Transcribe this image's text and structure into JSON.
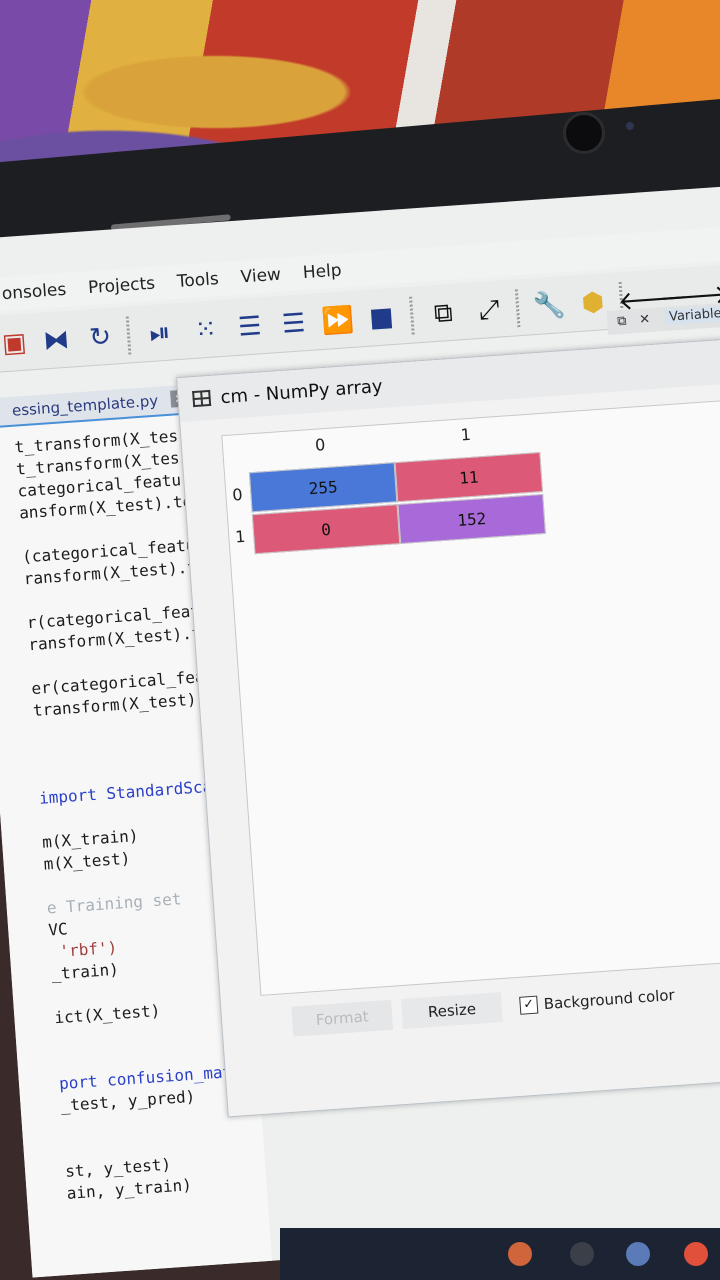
{
  "menu": {
    "items": [
      "onsoles",
      "Projects",
      "Tools",
      "View",
      "Help"
    ]
  },
  "toolbar": {
    "icons": [
      "run-cell-icon",
      "debug-icon",
      "indent-icon",
      "outdent-icon",
      "fast-forward-icon",
      "stop-icon",
      "maximize-pane-icon",
      "fullscreen-icon",
      "wrench-icon",
      "python-icon",
      "back-arrow-icon",
      "forward-arrow-icon"
    ]
  },
  "right_pane": {
    "label": "Variable"
  },
  "editor": {
    "tab_title": "essing_template.py",
    "tab_close": "×",
    "lines": [
      {
        "t": "t_transform(X_tes",
        "cls": ""
      },
      {
        "t": "t_transform(X_tes",
        "cls": ""
      },
      {
        "t": "categorical_featu",
        "cls": ""
      },
      {
        "t": "ansform(X_test).to",
        "cls": ""
      },
      {
        "t": "",
        "cls": ""
      },
      {
        "t": "(categorical_featu",
        "cls": ""
      },
      {
        "t": "ransform(X_test).to",
        "cls": ""
      },
      {
        "t": "",
        "cls": ""
      },
      {
        "t": "r(categorical_featu",
        "cls": ""
      },
      {
        "t": "ransform(X_test).to",
        "cls": ""
      },
      {
        "t": "",
        "cls": ""
      },
      {
        "t": "er(categorical_featu",
        "cls": ""
      },
      {
        "t": "transform(X_test).to",
        "cls": ""
      },
      {
        "t": "",
        "cls": ""
      },
      {
        "t": "",
        "cls": ""
      },
      {
        "t": "",
        "cls": ""
      },
      {
        "t": "import StandardScaler",
        "cls": "k"
      },
      {
        "t": "",
        "cls": ""
      },
      {
        "t": "m(X_train)",
        "cls": ""
      },
      {
        "t": "m(X_test)",
        "cls": ""
      },
      {
        "t": "",
        "cls": ""
      },
      {
        "t": "e Training set",
        "cls": "c"
      },
      {
        "t": "VC",
        "cls": ""
      },
      {
        "t": " 'rbf')",
        "cls": "s"
      },
      {
        "t": "_train)",
        "cls": ""
      },
      {
        "t": "",
        "cls": ""
      },
      {
        "t": "ict(X_test)",
        "cls": ""
      },
      {
        "t": "",
        "cls": ""
      },
      {
        "t": "",
        "cls": ""
      },
      {
        "t": "port confusion_matrix",
        "cls": "k"
      },
      {
        "t": "_test, y_pred)",
        "cls": ""
      },
      {
        "t": "",
        "cls": ""
      },
      {
        "t": "",
        "cls": ""
      },
      {
        "t": "st, y_test)",
        "cls": ""
      },
      {
        "t": "ain, y_train)",
        "cls": ""
      }
    ]
  },
  "dialog": {
    "title": "cm - NumPy array",
    "col_headers": [
      "0",
      "1"
    ],
    "row_headers": [
      "0",
      "1"
    ],
    "cells": [
      [
        {
          "v": "255",
          "color": "#4a78d8"
        },
        {
          "v": "11",
          "color": "#dc5a78"
        }
      ],
      [
        {
          "v": "0",
          "color": "#dc5a78"
        },
        {
          "v": "152",
          "color": "#a86ad8"
        }
      ]
    ],
    "format_button": "Format",
    "resize_button": "Resize",
    "background_color_label": "Background color",
    "background_color_checked": "✓"
  }
}
